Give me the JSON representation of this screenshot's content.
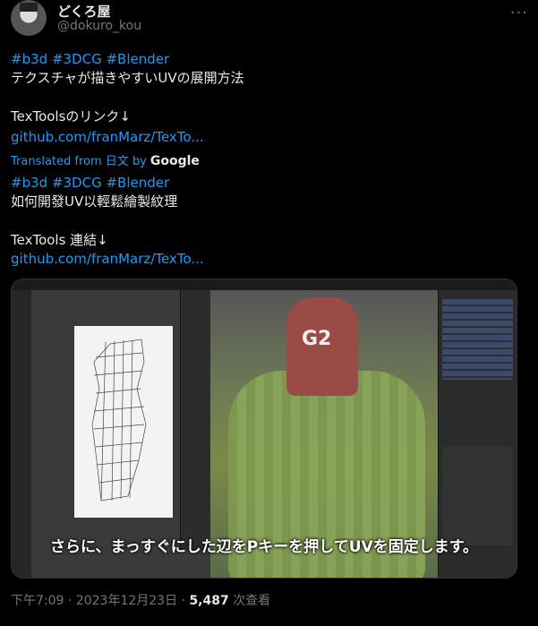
{
  "author": {
    "name": "どくろ屋",
    "handle": "@dokuro_kou"
  },
  "tweet": {
    "hashtags_1": [
      "#b3d",
      "#3DCG",
      "#Blender"
    ],
    "line_1": "テクスチャが描きやすいUVの展開方法",
    "line_2": "TexToolsのリンク↓",
    "link_1": "github.com/franMarz/TexTo...",
    "translated_label": "Translated from 日文 by",
    "translated_brand": "Google",
    "hashtags_2": [
      "#b3d",
      "#3DCG",
      "#Blender"
    ],
    "line_3": "如何開發UV以輕鬆繪製紋理",
    "line_4": "TexTools 連結↓",
    "link_2": "github.com/franMarz/TexTo..."
  },
  "media": {
    "subtitle": "さらに、まっすぐにした辺をPキーを押してUVを固定します。",
    "model_label": "G2"
  },
  "meta": {
    "time": "下午7:09",
    "sep_1": "·",
    "date": "2023年12月23日",
    "sep_2": "·",
    "views": "5,487",
    "views_label": "次查看"
  },
  "icons": {
    "more": "more-icon"
  }
}
